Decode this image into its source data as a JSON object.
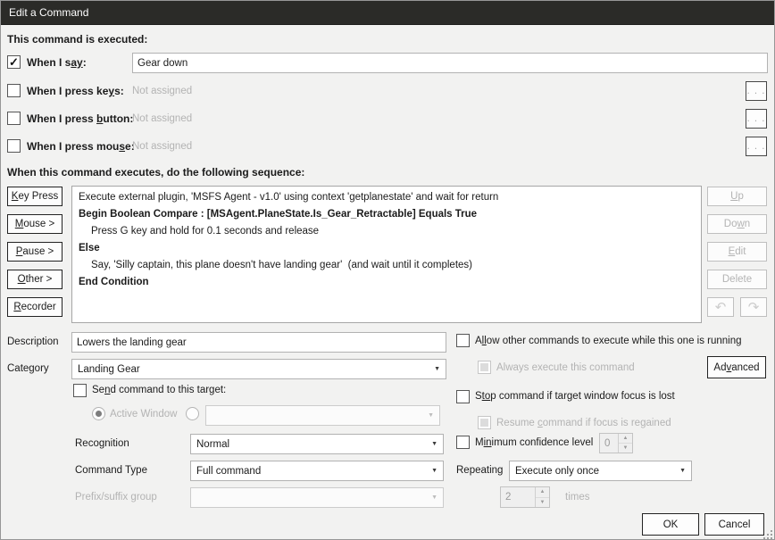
{
  "window": {
    "title": "Edit a Command"
  },
  "headings": {
    "executed": "This command is executed:",
    "sequence": "When this command executes, do the following sequence:"
  },
  "icons": {
    "check": "✓",
    "dropdown": "▼",
    "spin_up": "▲",
    "spin_down": "▼",
    "undo": "↶",
    "redo": "↷"
  },
  "triggers": {
    "browse_label": ". . .",
    "say": {
      "pre": "When I s",
      "u": "ay",
      "post": ":",
      "value": "Gear down"
    },
    "keys": {
      "pre": "When I press ke",
      "u": "y",
      "post": "s:",
      "value": "Not assigned"
    },
    "button": {
      "pre": "When I press ",
      "u": "b",
      "post": "utton:",
      "value": "Not assigned"
    },
    "mouse": {
      "pre": "When I press mou",
      "u": "s",
      "post": "e:",
      "value": "Not assigned"
    }
  },
  "action_buttons": {
    "key_press": {
      "u": "K",
      "post": "ey Press"
    },
    "mouse": {
      "u": "M",
      "post": "ouse >"
    },
    "pause": {
      "u": "P",
      "post": "ause >"
    },
    "other": {
      "u": "O",
      "post": "ther >"
    },
    "recorder": {
      "u": "R",
      "post": "ecorder"
    }
  },
  "sequence": {
    "lines": [
      {
        "text": "Execute external plugin, 'MSFS Agent - v1.0' using context 'getplanestate' and wait for return"
      },
      {
        "text": "Begin Boolean Compare : [MSAgent.PlaneState.Is_Gear_Retractable] Equals True"
      },
      {
        "text": "Press G key and hold for 0.1 seconds and release"
      },
      {
        "text": "Else"
      },
      {
        "text": "Say, 'Silly captain, this plane doesn't have landing gear'  (and wait until it completes)"
      },
      {
        "text": "End Condition"
      }
    ]
  },
  "edit_buttons": {
    "up": {
      "u": "U",
      "post": "p"
    },
    "down": {
      "pre": "Do",
      "u": "w",
      "post": "n"
    },
    "edit": {
      "u": "E",
      "post": "dit"
    },
    "delete": {
      "pre": "Delete"
    }
  },
  "fields": {
    "description": {
      "label": "Description",
      "value": "Lowers the landing gear"
    },
    "category": {
      "label": "Category",
      "value": "Landing Gear"
    },
    "recognition": {
      "label": "Recognition",
      "value": "Normal"
    },
    "command_type": {
      "label": "Command Type",
      "value": "Full command"
    },
    "prefix_group": {
      "label": "Prefix/suffix group",
      "value": ""
    }
  },
  "target": {
    "send": {
      "pre": "Se",
      "u": "n",
      "post": "d command to this target:"
    },
    "active_window": "Active Window",
    "window_value": ""
  },
  "options": {
    "allow": {
      "pre": "A",
      "u": "ll",
      "post": "ow other commands to execute while this one is running"
    },
    "always": "Always execute this command",
    "advanced": {
      "pre": "Ad",
      "u": "v",
      "post": "anced"
    },
    "stop": {
      "pre": "S",
      "u": "to",
      "post": "p command if target window focus is lost"
    },
    "resume": {
      "pre": "Resume ",
      "u": "c",
      "post": "ommand if focus is regained"
    },
    "min_confidence": {
      "pre": "M",
      "u": "in",
      "post": "imum confidence level",
      "value": "0"
    }
  },
  "repeating": {
    "label": "Repeating",
    "value": "Execute only once",
    "times_value": "2",
    "times_label": "times"
  },
  "footer": {
    "ok": "OK",
    "cancel": "Cancel"
  }
}
